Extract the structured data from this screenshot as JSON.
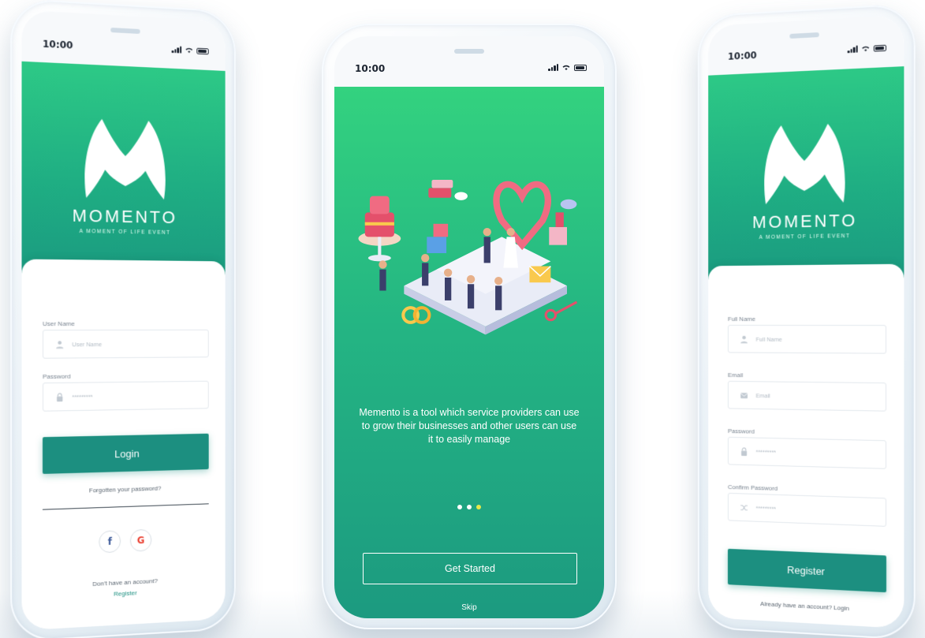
{
  "colors": {
    "brand_green_light": "#33d27f",
    "brand_green_dark": "#1c9a80",
    "primary_button": "#1c8f80",
    "active_dot": "#e6e84a",
    "facebook": "#3b5998",
    "google": "#ea4335"
  },
  "status_bar": {
    "time": "10:00",
    "icons": [
      "cellular-signal-icon",
      "wifi-icon",
      "battery-icon"
    ]
  },
  "login_screen": {
    "brand": "MOMENTO",
    "tagline": "A MOMENT OF LIFE EVENT",
    "username": {
      "label": "User Name",
      "placeholder": "User Name",
      "icon": "user-icon"
    },
    "password": {
      "label": "Password",
      "placeholder": "*********",
      "icon": "lock-icon"
    },
    "login_label": "Login",
    "forgot_label": "Forgotten your password?",
    "social": {
      "facebook": "f",
      "google": "G"
    },
    "no_account": "Don't have an account?",
    "register_link": "Register"
  },
  "onboarding_screen": {
    "description": "Memento is a tool which service providers can use to grow their businesses and other users can use it to easily manage",
    "pager": {
      "count": 3,
      "active": 3
    },
    "get_started_label": "Get Started",
    "skip_label": "Skip"
  },
  "register_screen": {
    "brand": "MOMENTO",
    "tagline": "A MOMENT OF LIFE EVENT",
    "full_name": {
      "label": "Full Name",
      "placeholder": "Full Name",
      "icon": "user-icon"
    },
    "email": {
      "label": "Email",
      "placeholder": "Email",
      "icon": "email-icon"
    },
    "password": {
      "label": "Password",
      "placeholder": "*********",
      "icon": "lock-icon"
    },
    "confirm_password": {
      "label": "Confirm Password",
      "placeholder": "*********",
      "icon": "shuffle-icon"
    },
    "register_label": "Register",
    "have_account": "Already have an account? Login"
  }
}
